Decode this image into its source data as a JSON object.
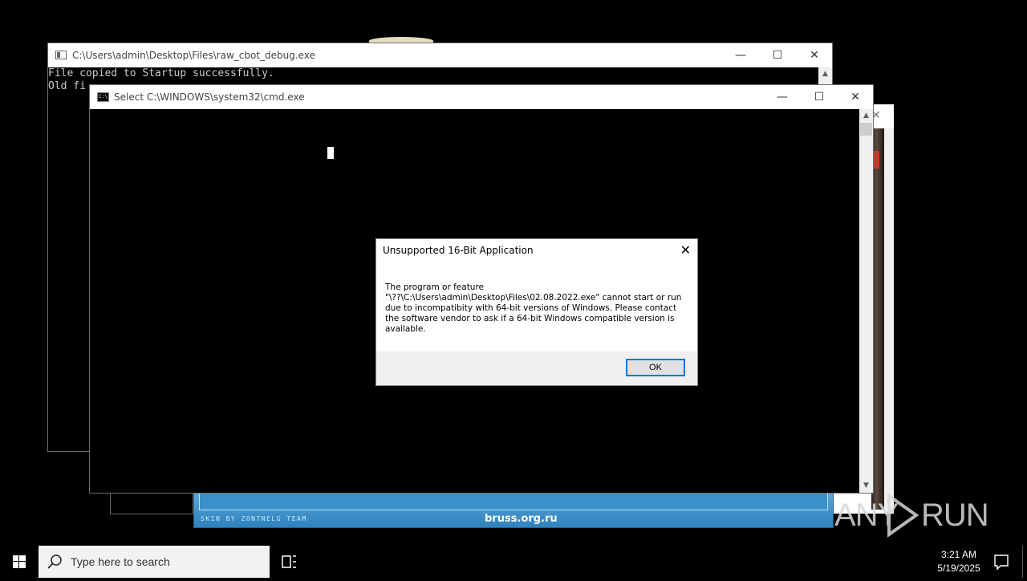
{
  "raw_window": {
    "title": "C:\\Users\\admin\\Desktop\\Files\\raw_cbot_debug.exe",
    "lines": [
      "File copied to Startup successfully.",
      "Old fi"
    ],
    "controls": {
      "minimize": "—",
      "maximize": "☐",
      "close": "✕"
    }
  },
  "cmd_window": {
    "title": "Select C:\\WINDOWS\\system32\\cmd.exe",
    "icon_text": "C:\\",
    "controls": {
      "minimize": "—",
      "maximize": "☐",
      "close": "✕"
    }
  },
  "skin_app": {
    "credit": "SKIN BY ZONTNELG TEAM",
    "url": "bruss.org.ru"
  },
  "dialog": {
    "title": "Unsupported 16-Bit Application",
    "close": "✕",
    "message_lines": [
      "The program or feature",
      "\"\\??\\C:\\Users\\admin\\Desktop\\Files\\02.08.2022.exe\" cannot start or run",
      "due to incompatibity with 64-bit versions of Windows. Please contact",
      "the software vendor to ask if a 64-bit Windows compatible version is",
      "available."
    ],
    "ok_label": "OK"
  },
  "watermark": {
    "left": "ANY",
    "right": "RUN"
  },
  "taskbar": {
    "search_placeholder": "Type here to search",
    "time": "3:21 AM",
    "date": "5/19/2025",
    "icons": [
      "windows-start-icon",
      "search-icon",
      "task-view-icon",
      "notification-icon"
    ]
  }
}
